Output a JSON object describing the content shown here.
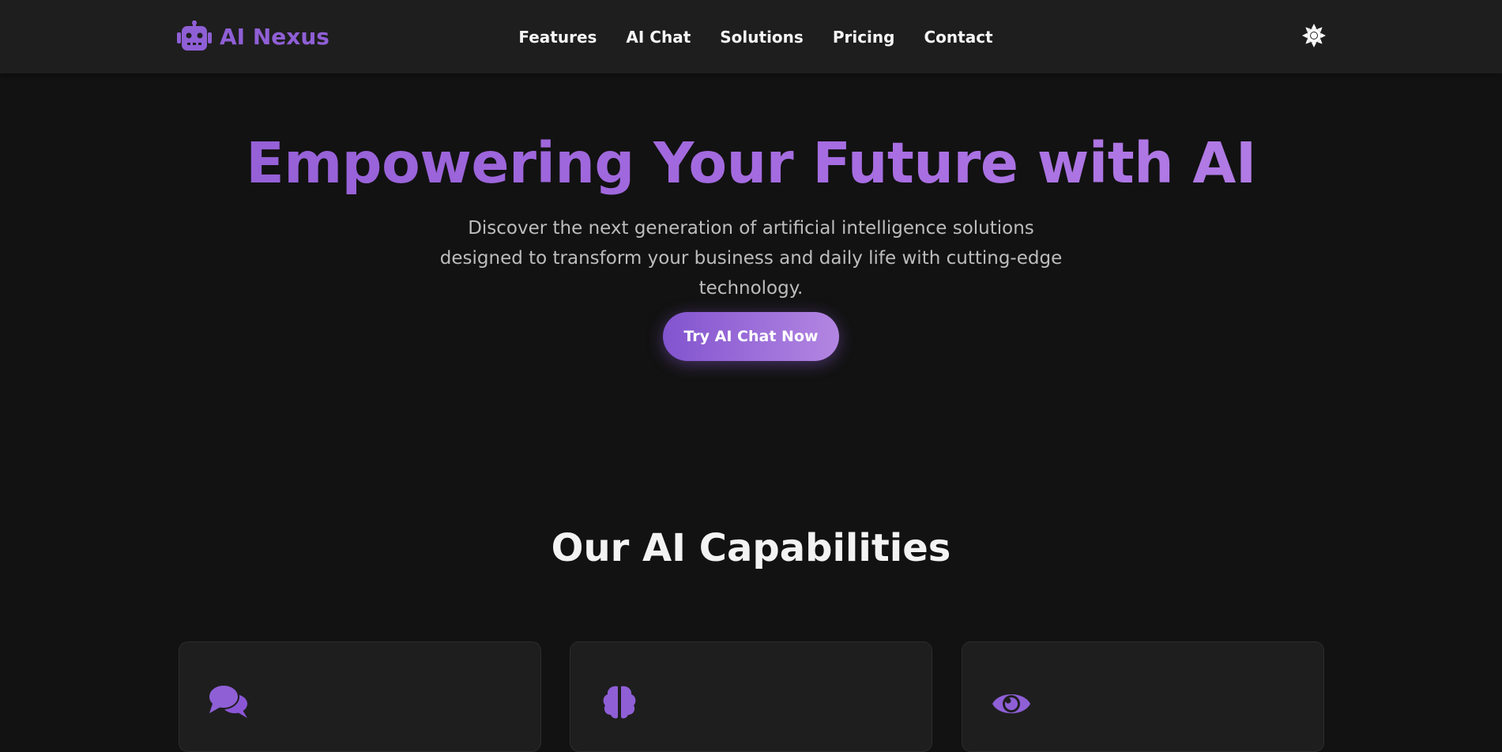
{
  "brand": {
    "name": "AI Nexus",
    "icon": "robot-icon"
  },
  "nav": {
    "links": [
      "Features",
      "AI Chat",
      "Solutions",
      "Pricing",
      "Contact"
    ],
    "theme_toggle_icon": "sun-icon"
  },
  "hero": {
    "title": "Empowering Your Future with AI",
    "subtitle": "Discover the next generation of artificial intelligence solutions designed to transform your business and daily life with cutting-edge technology.",
    "cta_label": "Try AI Chat Now"
  },
  "capabilities": {
    "title": "Our AI Capabilities",
    "cards": [
      {
        "icon": "comments-icon"
      },
      {
        "icon": "brain-icon"
      },
      {
        "icon": "eye-icon"
      }
    ]
  },
  "colors": {
    "accent": "#8f5fd6",
    "background": "#121212",
    "nav_background": "#1e1e1e",
    "card_background": "#1e1e1e"
  }
}
